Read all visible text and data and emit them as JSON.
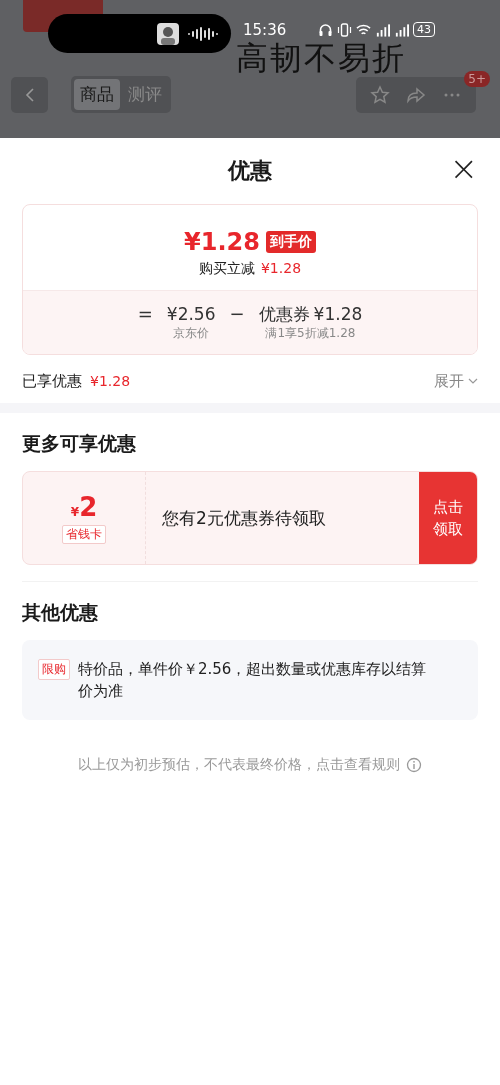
{
  "status_bar": {
    "time": "15:36",
    "battery": "43"
  },
  "background_page": {
    "banner_text": "高韧不易折",
    "tabs": [
      {
        "label": "商品",
        "selected": true
      },
      {
        "label": "测评",
        "selected": false
      }
    ],
    "badge": "5+"
  },
  "sheet": {
    "title": "优惠",
    "close": "×",
    "price_card": {
      "price": "¥1.28",
      "price_tag": "到手价",
      "reduction_label": "购买立减",
      "reduction_value": "¥1.28",
      "equals": "=",
      "base_price": "¥2.56",
      "base_label": "京东价",
      "minus": "−",
      "coupon_label": "优惠券",
      "coupon_value": "¥1.28",
      "coupon_rule": "满1享5折减1.28"
    },
    "enjoyed_label": "已享优惠",
    "enjoyed_value": "¥1.28",
    "expand": "展开",
    "more_title": "更多可享优惠",
    "coupon_offer": {
      "currency": "¥",
      "amount": "2",
      "card_tag": "省钱卡",
      "text": "您有2元优惠券待领取",
      "button": "点击领取"
    },
    "other_title": "其他优惠",
    "other_offers": [
      {
        "tag": "限购",
        "text": "特价品，单件价￥2.56，超出数量或优惠库存以结算价为准"
      }
    ],
    "footnote": "以上仅为初步预估，不代表最终价格，点击查看规则"
  }
}
